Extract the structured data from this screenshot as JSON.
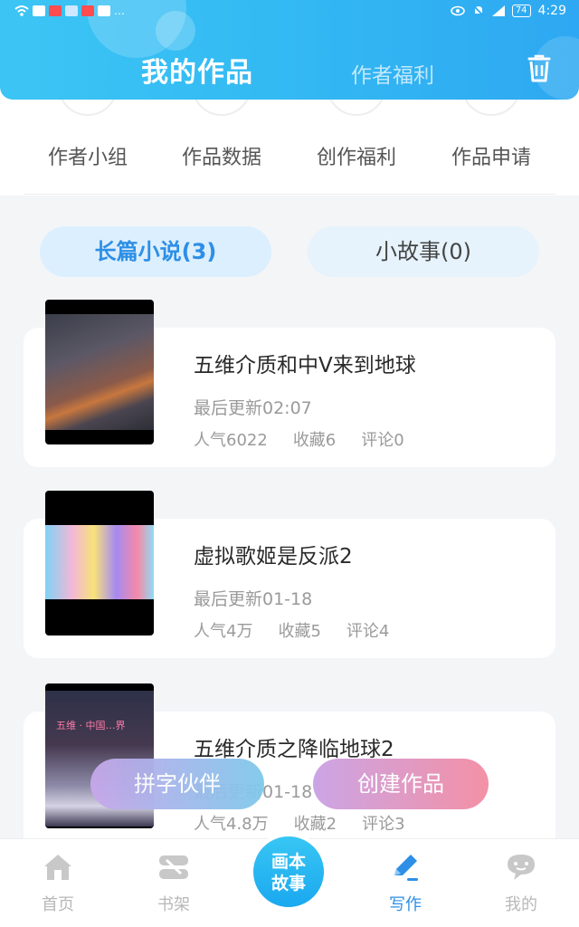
{
  "status_bar": {
    "dots": "…",
    "battery": "74",
    "time": "4:29"
  },
  "header": {
    "active_tab": "我的作品",
    "tab": "作者福利",
    "trash_icon": "trash-icon"
  },
  "tools": [
    {
      "label": "作者小组"
    },
    {
      "label": "作品数据"
    },
    {
      "label": "创作福利"
    },
    {
      "label": "作品申请"
    }
  ],
  "categories": {
    "novel": "长篇小说(3)",
    "story": "小故事(0)"
  },
  "works": [
    {
      "title": "五维介质和中V来到地球",
      "updated": "最后更新02:07",
      "popularity": "人气6022",
      "favorites": "收藏6",
      "comments": "评论0"
    },
    {
      "title": "虚拟歌姬是反派2",
      "updated": "最后更新01-18",
      "popularity": "人气4万",
      "favorites": "收藏5",
      "comments": "评论4"
    },
    {
      "title": "五维介质之降临地球2",
      "updated": "最后更新01-18",
      "popularity": "人气4.8万",
      "favorites": "收藏2",
      "comments": "评论3",
      "cover_text": "五维 · 中国…界"
    }
  ],
  "float_buttons": {
    "partner": "拼字伙伴",
    "create": "创建作品"
  },
  "center_fab": {
    "line1": "画本",
    "line2": "故事"
  },
  "bottom_nav": [
    {
      "label": "首页",
      "icon": "home-icon"
    },
    {
      "label": "书架",
      "icon": "bookshelf-icon"
    },
    {
      "label": "写作",
      "icon": "pen-icon"
    },
    {
      "label": "我的",
      "icon": "chat-face-icon"
    }
  ],
  "colors": {
    "header": "#33b9f3",
    "accent": "#2d8fe6",
    "create_gradient_end": "#f38ba1"
  }
}
